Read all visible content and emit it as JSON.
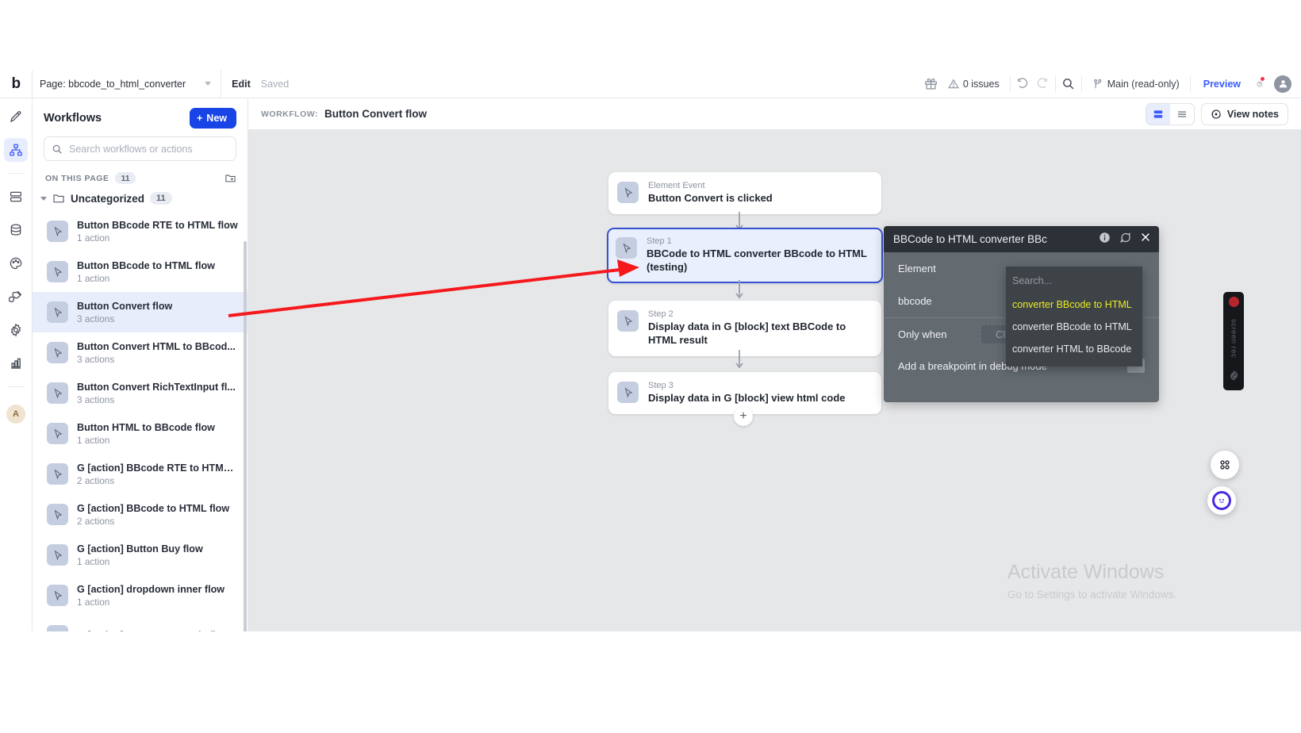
{
  "topbar": {
    "brand": "b",
    "page_label": "Page: bbcode_to_html_converter",
    "edit_label": "Edit",
    "saved_label": "Saved",
    "issues_label": "0 issues",
    "branch_label": "Main (read-only)",
    "preview_label": "Preview",
    "icons": [
      "gift-icon",
      "warning-icon",
      "undo-icon",
      "redo-icon",
      "search-icon",
      "branch-icon",
      "help-icon",
      "account-avatar"
    ]
  },
  "rail": {
    "items": [
      {
        "name": "design-icon"
      },
      {
        "name": "workflow-icon",
        "active": true
      },
      {
        "name": "layers-icon"
      },
      {
        "name": "data-icon"
      },
      {
        "name": "styles-icon"
      },
      {
        "name": "plugins-icon"
      },
      {
        "name": "settings-icon"
      },
      {
        "name": "logs-icon"
      }
    ],
    "avatar_initial": "A"
  },
  "sidebar": {
    "title": "Workflows",
    "new_button": "New",
    "search_placeholder": "Search workflows or actions",
    "section_label": "ON THIS PAGE",
    "section_count": "11",
    "folder_name": "Uncategorized",
    "folder_count": "11",
    "items": [
      {
        "name": "Button BBcode RTE to HTML flow",
        "actions": "1 action",
        "selected": false
      },
      {
        "name": "Button BBcode to HTML flow",
        "actions": "1 action",
        "selected": false
      },
      {
        "name": "Button Convert flow",
        "actions": "3 actions",
        "selected": true
      },
      {
        "name": "Button Convert HTML to BBcod...",
        "actions": "3 actions",
        "selected": false
      },
      {
        "name": "Button Convert RichTextInput fl...",
        "actions": "3 actions",
        "selected": false
      },
      {
        "name": "Button HTML to BBcode flow",
        "actions": "1 action",
        "selected": false
      },
      {
        "name": "G [action] BBcode RTE to HTML ...",
        "actions": "2 actions",
        "selected": false
      },
      {
        "name": "G [action] BBcode to HTML flow",
        "actions": "2 actions",
        "selected": false
      },
      {
        "name": "G [action] Button Buy flow",
        "actions": "1 action",
        "selected": false
      },
      {
        "name": "G [action] dropdown inner flow",
        "actions": "1 action",
        "selected": false
      },
      {
        "name": "G [action] HTML to BBcode flow",
        "actions": "",
        "selected": false
      }
    ]
  },
  "workflow_header": {
    "kicker": "WORKFLOW:",
    "name": "Button Convert flow",
    "notes_button": "View notes"
  },
  "flow": {
    "event": {
      "kicker": "Element Event",
      "title": "Button Convert is clicked"
    },
    "steps": [
      {
        "kicker": "Step 1",
        "title": "BBCode to HTML converter BBcode to HTML (testing)",
        "selected": true
      },
      {
        "kicker": "Step 2",
        "title": "Display data in G [block] text BBCode to HTML result",
        "selected": false
      },
      {
        "kicker": "Step 3",
        "title": "Display data in G [block] view html code",
        "selected": false
      }
    ],
    "add_label": "+"
  },
  "panel": {
    "title": "BBCode to HTML converter BBc",
    "element_label": "Element",
    "bbcode_label": "bbcode",
    "only_when_label": "Only when",
    "only_when_value": "Click",
    "breakpoint_label": "Add a breakpoint in debug mode",
    "search_placeholder": "Search...",
    "options": [
      {
        "label": "converter BBcode to HTML",
        "highlighted": true
      },
      {
        "label": "converter BBcode to HTML",
        "highlighted": false
      },
      {
        "label": "converter HTML to BBcode",
        "highlighted": false
      }
    ]
  },
  "overlay": {
    "activate_title": "Activate Windows",
    "activate_sub": "Go to Settings to activate Windows.",
    "screenrec_label": "screen rec"
  },
  "colors": {
    "accent_blue": "#3b5bfd",
    "new_button": "#1944e6",
    "selected_node_border": "#3652d4",
    "highlight_yellow": "#ecec22",
    "arrow_red": "#f5191d",
    "canvas_bg": "#e6e7e9"
  }
}
